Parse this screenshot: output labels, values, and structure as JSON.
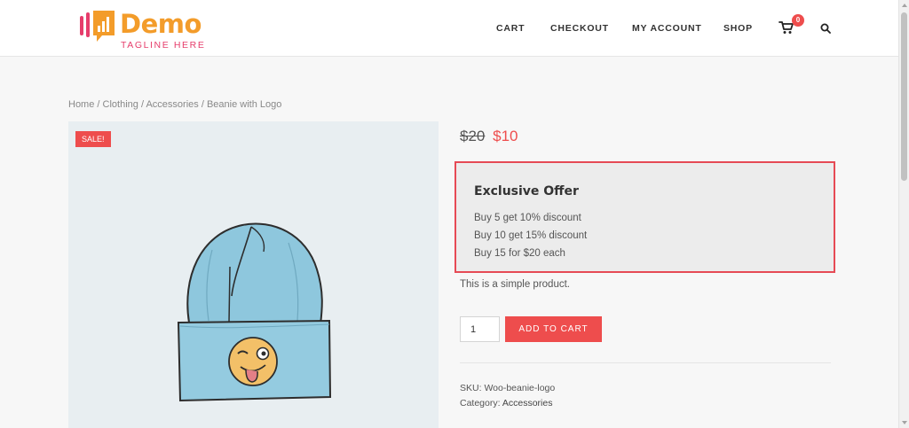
{
  "brand": {
    "name": "Demo",
    "tagline": "TAGLINE HERE",
    "colors": {
      "primary": "#f39c2a",
      "accent": "#e63d6b"
    }
  },
  "nav": {
    "items": [
      {
        "label": "CART"
      },
      {
        "label": "CHECKOUT"
      },
      {
        "label": "MY ACCOUNT"
      },
      {
        "label": "SHOP"
      }
    ],
    "cart_count": "0",
    "icons": [
      "cart-icon",
      "search-icon"
    ]
  },
  "breadcrumb": {
    "items": [
      "Home",
      "Clothing",
      "Accessories"
    ],
    "current": "Beanie with Logo",
    "separator": "/"
  },
  "product": {
    "badge": "SALE!",
    "price_old": "$20",
    "price_new": "$10",
    "short_description": "This is a simple product.",
    "quantity": "1",
    "add_to_cart_label": "ADD TO CART",
    "sku_label": "SKU:",
    "sku_value": "Woo-beanie-logo",
    "category_label": "Category:",
    "category_value": "Accessories"
  },
  "offer": {
    "title": "Exclusive Offer",
    "lines": [
      "Buy 5 get 10% discount",
      "Buy 10 get 15% discount",
      "Buy 15 for $20 each"
    ],
    "border_color": "#e64a55"
  },
  "theme": {
    "sale_color": "#ee4d4d"
  }
}
